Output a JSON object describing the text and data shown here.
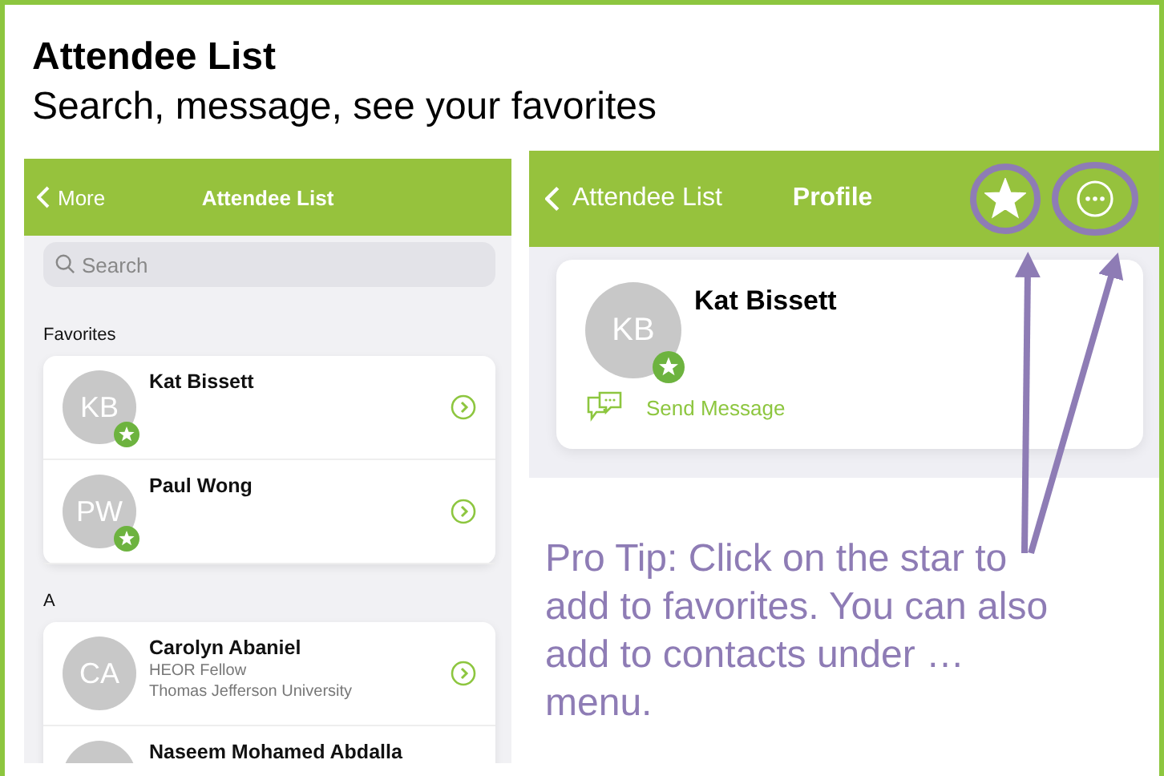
{
  "slide": {
    "title": "Attendee List",
    "subtitle": "Search, message, see your favorites"
  },
  "list_screen": {
    "nav": {
      "back_label": "More",
      "title": "Attendee List"
    },
    "search": {
      "placeholder": "Search"
    },
    "sections": [
      {
        "heading": "Favorites",
        "attendees": [
          {
            "initials": "KB",
            "name": "Kat Bissett",
            "favorite": true
          },
          {
            "initials": "PW",
            "name": "Paul Wong",
            "favorite": true
          }
        ]
      },
      {
        "heading": "A",
        "attendees": [
          {
            "initials": "CA",
            "name": "Carolyn Abaniel",
            "details": [
              "HEOR Fellow",
              "Thomas Jefferson University"
            ],
            "favorite": false
          },
          {
            "name": "Naseem Mohamed Abdalla"
          }
        ]
      }
    ]
  },
  "profile_screen": {
    "nav": {
      "back_label": "Attendee List",
      "title": "Profile"
    },
    "profile": {
      "initials": "KB",
      "name": "Kat Bissett",
      "favorite": true,
      "action": "Send Message"
    }
  },
  "tip": "Pro Tip: Click on the star to add to favorites. You can also add to contacts under … menu."
}
